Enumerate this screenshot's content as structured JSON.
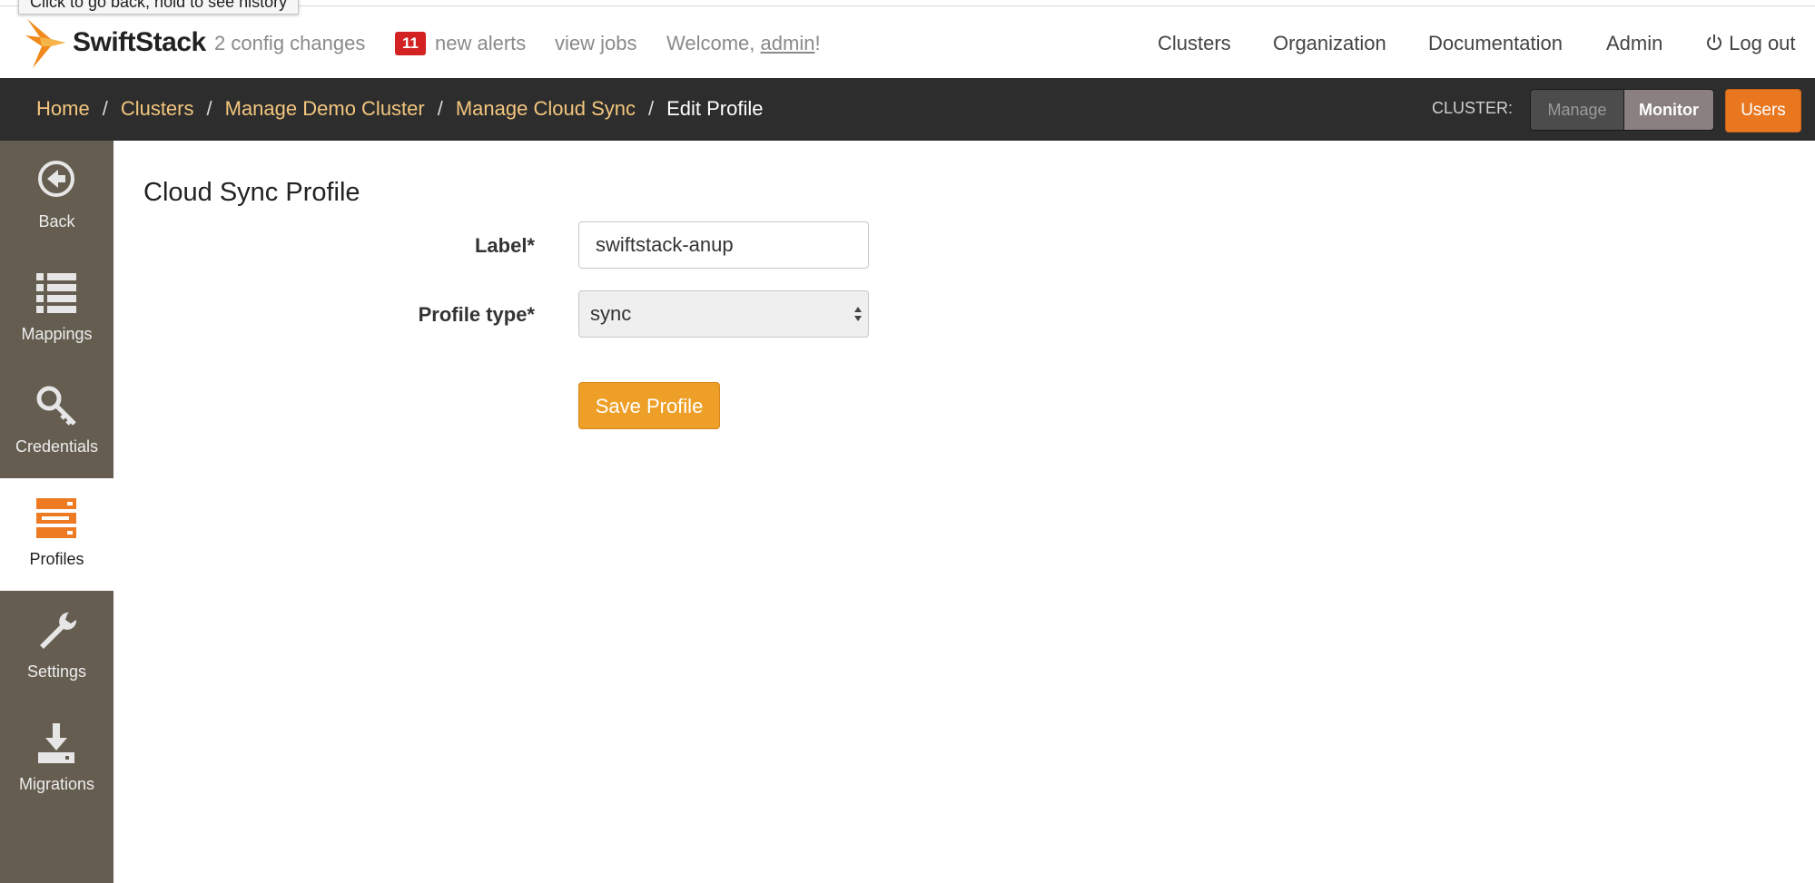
{
  "tooltip": "Click to go back, hold to see history",
  "header": {
    "brand": "SwiftStack",
    "config_changes": "2 config changes",
    "alerts_count": "11",
    "alerts_label": "new alerts",
    "view_jobs": "view jobs",
    "welcome_prefix": "Welcome, ",
    "welcome_user": "admin",
    "welcome_suffix": "!",
    "nav": [
      "Clusters",
      "Organization",
      "Documentation",
      "Admin",
      "Log out"
    ]
  },
  "breadcrumb": {
    "items": [
      "Home",
      "Clusters",
      "Manage Demo Cluster",
      "Manage Cloud Sync"
    ],
    "current": "Edit Profile",
    "separator": "/"
  },
  "cluster_controls": {
    "label": "CLUSTER:",
    "manage": "Manage",
    "monitor": "Monitor",
    "users": "Users"
  },
  "sidebar": {
    "items": [
      {
        "label": "Back",
        "icon": "back-arrow-icon"
      },
      {
        "label": "Mappings",
        "icon": "list-icon"
      },
      {
        "label": "Credentials",
        "icon": "key-icon"
      },
      {
        "label": "Profiles",
        "icon": "server-stack-icon",
        "active": true
      },
      {
        "label": "Settings",
        "icon": "wrench-icon"
      },
      {
        "label": "Migrations",
        "icon": "download-icon"
      }
    ]
  },
  "form": {
    "title": "Cloud Sync Profile",
    "label_field": {
      "label": "Label*",
      "value": "swiftstack-anup"
    },
    "profile_type": {
      "label": "Profile type*",
      "value": "sync"
    },
    "save_label": "Save Profile"
  },
  "colors": {
    "accent_orange": "#ee9f27",
    "users_orange": "#e8771f",
    "alert_red": "#d32222",
    "sidebar_bg": "#655d50",
    "crumb_bar_bg": "#2d2d2d",
    "crumb_link": "#f3c67e"
  }
}
